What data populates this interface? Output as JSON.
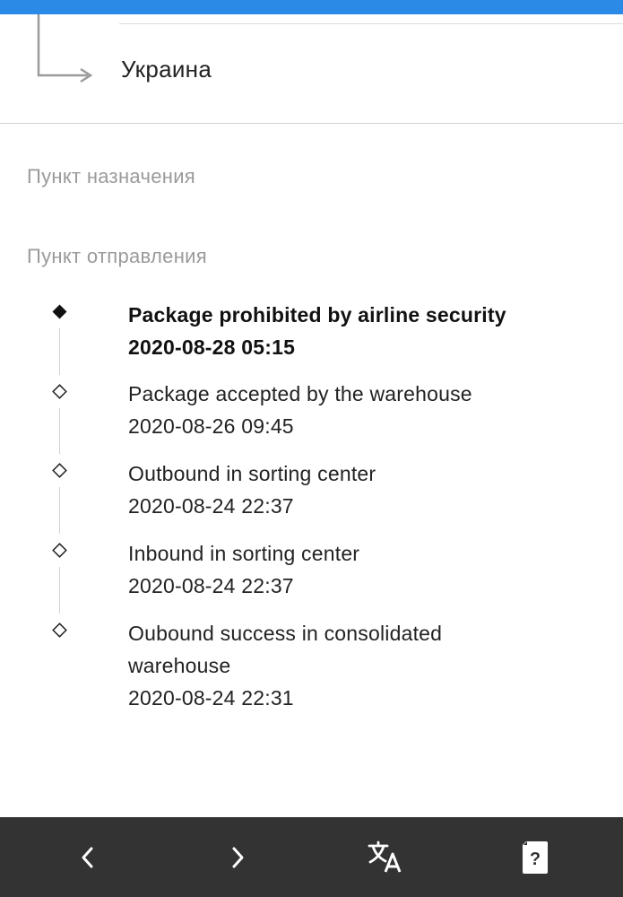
{
  "route": {
    "country": "Украина"
  },
  "sections": {
    "destination_label": "Пункт назначения",
    "origin_label": "Пункт отправления"
  },
  "events": [
    {
      "description": "Package prohibited by airline security",
      "time": "2020-08-28 05:15",
      "current": true
    },
    {
      "description": "Package accepted by the warehouse",
      "time": "2020-08-26 09:45",
      "current": false
    },
    {
      "description": "Outbound in sorting center",
      "time": "2020-08-24 22:37",
      "current": false
    },
    {
      "description": "Inbound in sorting center",
      "time": "2020-08-24 22:37",
      "current": false
    },
    {
      "description": "Oubound success in consolidated warehouse",
      "time": "2020-08-24 22:31",
      "current": false
    }
  ],
  "toolbar": {
    "back_icon": "chevron-left-icon",
    "forward_icon": "chevron-right-icon",
    "translate_icon": "translate-icon",
    "help_icon": "help-card-icon"
  },
  "colors": {
    "top_bar": "#2b8ae6",
    "bottom_bar": "#333333",
    "section_label": "#9a9a9a"
  }
}
